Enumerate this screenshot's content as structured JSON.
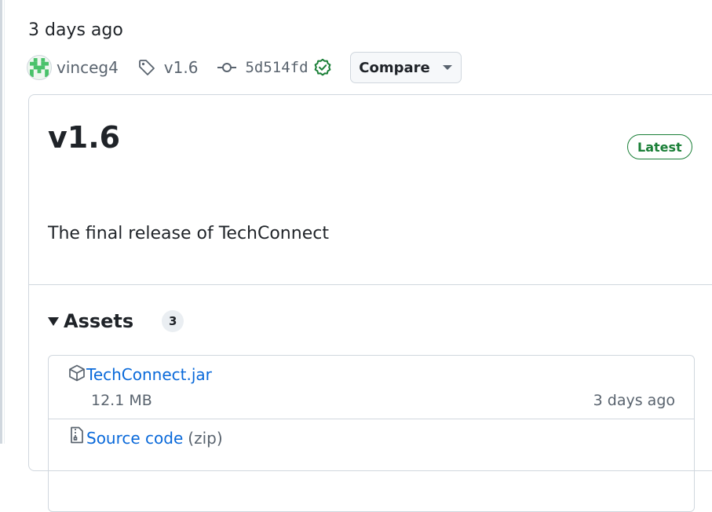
{
  "release": {
    "date": "3 days ago",
    "author": "vinceg4",
    "tag": "v1.6",
    "commit": "5d514fd",
    "compare_label": "Compare",
    "title": "v1.6",
    "badge": "Latest",
    "body": "The final release of TechConnect"
  },
  "assets": {
    "label": "Assets",
    "count": "3",
    "items": [
      {
        "name": "TechConnect.jar",
        "size": "12.1 MB",
        "date": "3 days ago"
      },
      {
        "name": "Source code",
        "suffix": "(zip)"
      }
    ]
  },
  "colors": {
    "link": "#0969da",
    "success": "#1a7f37",
    "muted": "#59636e",
    "border": "#d0d7de"
  },
  "icons": [
    "avatar-identicon",
    "tag-icon",
    "git-commit-icon",
    "verified-check-icon",
    "package-icon",
    "file-zip-icon"
  ]
}
